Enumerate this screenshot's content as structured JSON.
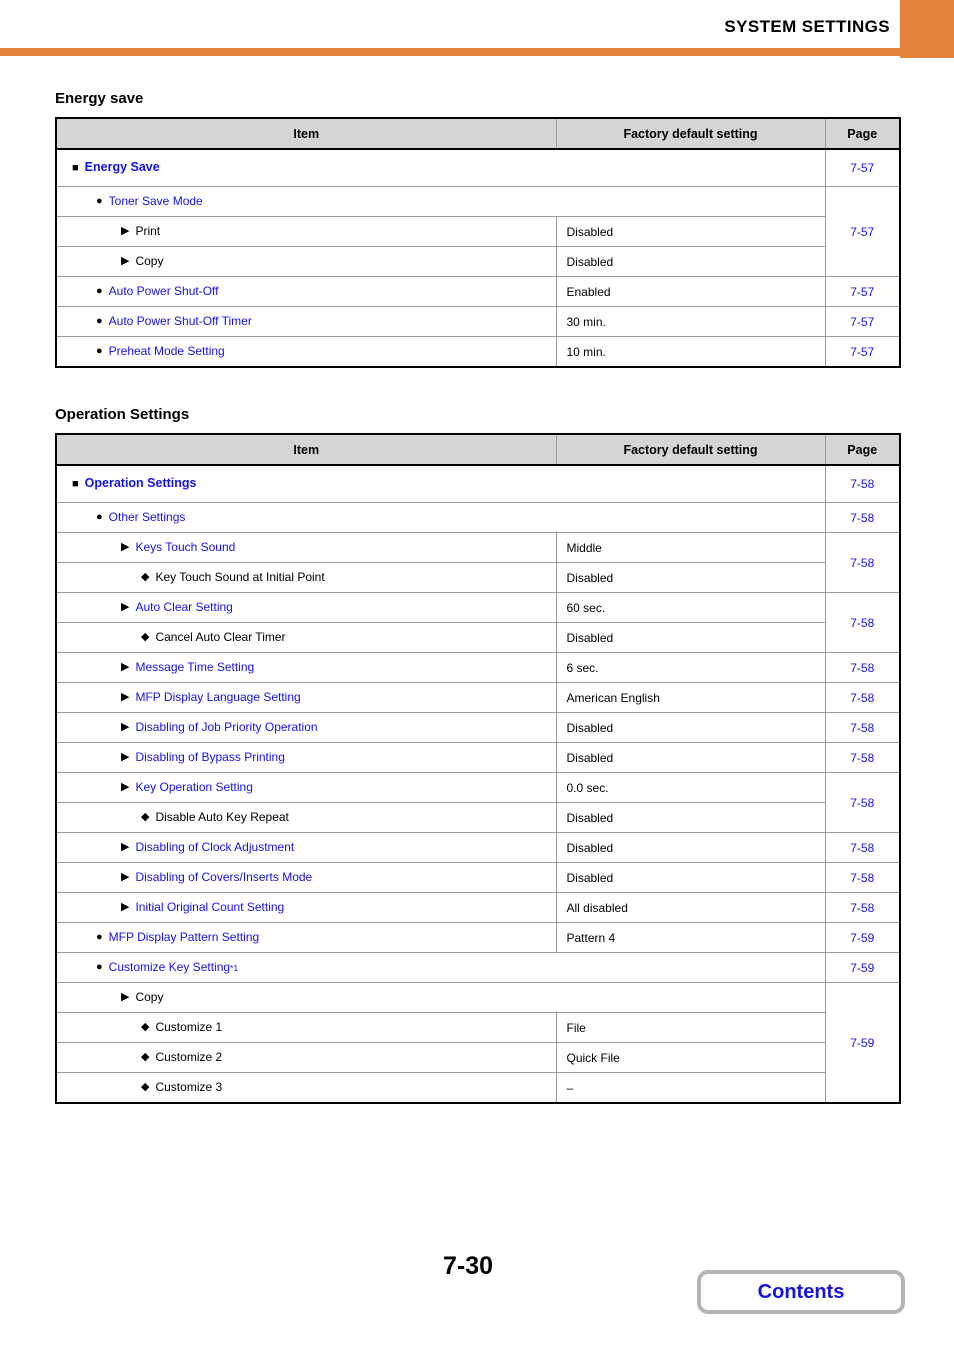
{
  "header": {
    "title": "SYSTEM SETTINGS",
    "accent_color": "#e5833a"
  },
  "link_color": "#1414e0",
  "columns": {
    "item": "Item",
    "default": "Factory default setting",
    "page": "Page"
  },
  "sections": [
    {
      "heading": "Energy save",
      "rows": [
        {
          "level": 1,
          "bullet": "square",
          "label": "Energy Save",
          "link": true,
          "value": null,
          "page": "7-57",
          "page_rowspan": 1,
          "full_width": true,
          "tall": true
        },
        {
          "level": 2,
          "bullet": "circle",
          "label": "Toner Save Mode",
          "link": true,
          "value": null,
          "page": "7-57",
          "page_rowspan": 3,
          "full_width": true,
          "tall": false
        },
        {
          "level": 3,
          "bullet": "tri",
          "label": "Print",
          "link": false,
          "value": "Disabled",
          "page": null,
          "page_rowspan": 0,
          "full_width": false,
          "tall": false
        },
        {
          "level": 3,
          "bullet": "tri",
          "label": "Copy",
          "link": false,
          "value": "Disabled",
          "page": null,
          "page_rowspan": 0,
          "full_width": false,
          "tall": false
        },
        {
          "level": 2,
          "bullet": "circle",
          "label": "Auto Power Shut-Off",
          "link": true,
          "value": "Enabled",
          "page": "7-57",
          "page_rowspan": 1,
          "full_width": false,
          "tall": false
        },
        {
          "level": 2,
          "bullet": "circle",
          "label": "Auto Power Shut-Off Timer",
          "link": true,
          "value": "30 min.",
          "page": "7-57",
          "page_rowspan": 1,
          "full_width": false,
          "tall": false
        },
        {
          "level": 2,
          "bullet": "circle",
          "label": "Preheat Mode Setting",
          "link": true,
          "value": "10 min.",
          "page": "7-57",
          "page_rowspan": 1,
          "full_width": false,
          "tall": false
        }
      ]
    },
    {
      "heading": "Operation Settings",
      "rows": [
        {
          "level": 1,
          "bullet": "square",
          "label": "Operation Settings",
          "link": true,
          "value": null,
          "page": "7-58",
          "page_rowspan": 1,
          "full_width": true,
          "tall": true
        },
        {
          "level": 2,
          "bullet": "circle",
          "label": "Other Settings",
          "link": true,
          "value": null,
          "page": "7-58",
          "page_rowspan": 1,
          "full_width": true,
          "tall": false
        },
        {
          "level": 3,
          "bullet": "tri",
          "label": "Keys Touch Sound",
          "link": true,
          "value": "Middle",
          "page": "7-58",
          "page_rowspan": 2,
          "full_width": false,
          "tall": false
        },
        {
          "level": 4,
          "bullet": "diamond",
          "label": "Key Touch Sound at Initial Point",
          "link": false,
          "value": "Disabled",
          "page": null,
          "page_rowspan": 0,
          "full_width": false,
          "tall": false
        },
        {
          "level": 3,
          "bullet": "tri",
          "label": "Auto Clear Setting",
          "link": true,
          "value": "60 sec.",
          "page": "7-58",
          "page_rowspan": 2,
          "full_width": false,
          "tall": false
        },
        {
          "level": 4,
          "bullet": "diamond",
          "label": "Cancel Auto Clear Timer",
          "link": false,
          "value": "Disabled",
          "page": null,
          "page_rowspan": 0,
          "full_width": false,
          "tall": false
        },
        {
          "level": 3,
          "bullet": "tri",
          "label": "Message Time Setting",
          "link": true,
          "value": "6 sec.",
          "page": "7-58",
          "page_rowspan": 1,
          "full_width": false,
          "tall": false
        },
        {
          "level": 3,
          "bullet": "tri",
          "label": "MFP Display Language Setting",
          "link": true,
          "value": "American English",
          "page": "7-58",
          "page_rowspan": 1,
          "full_width": false,
          "tall": false
        },
        {
          "level": 3,
          "bullet": "tri",
          "label": "Disabling of Job Priority Operation",
          "link": true,
          "value": "Disabled",
          "page": "7-58",
          "page_rowspan": 1,
          "full_width": false,
          "tall": false
        },
        {
          "level": 3,
          "bullet": "tri",
          "label": "Disabling of Bypass Printing",
          "link": true,
          "value": "Disabled",
          "page": "7-58",
          "page_rowspan": 1,
          "full_width": false,
          "tall": false
        },
        {
          "level": 3,
          "bullet": "tri",
          "label": "Key Operation Setting",
          "link": true,
          "value": "0.0 sec.",
          "page": "7-58",
          "page_rowspan": 2,
          "full_width": false,
          "tall": false
        },
        {
          "level": 4,
          "bullet": "diamond",
          "label": "Disable Auto Key Repeat",
          "link": false,
          "value": "Disabled",
          "page": null,
          "page_rowspan": 0,
          "full_width": false,
          "tall": false
        },
        {
          "level": 3,
          "bullet": "tri",
          "label": "Disabling of Clock Adjustment",
          "link": true,
          "value": "Disabled",
          "page": "7-58",
          "page_rowspan": 1,
          "full_width": false,
          "tall": false
        },
        {
          "level": 3,
          "bullet": "tri",
          "label": "Disabling of Covers/Inserts Mode",
          "link": true,
          "value": "Disabled",
          "page": "7-58",
          "page_rowspan": 1,
          "full_width": false,
          "tall": false
        },
        {
          "level": 3,
          "bullet": "tri",
          "label": "Initial Original Count Setting",
          "link": true,
          "value": "All disabled",
          "page": "7-58",
          "page_rowspan": 1,
          "full_width": false,
          "tall": false
        },
        {
          "level": 2,
          "bullet": "circle",
          "label": "MFP Display Pattern Setting",
          "link": true,
          "value": "Pattern 4",
          "page": "7-59",
          "page_rowspan": 1,
          "full_width": false,
          "tall": false
        },
        {
          "level": 2,
          "bullet": "circle",
          "label": "Customize Key Setting",
          "link": true,
          "sup": "*1",
          "value": null,
          "page": "7-59",
          "page_rowspan": 1,
          "full_width": true,
          "tall": false
        },
        {
          "level": 3,
          "bullet": "tri",
          "label": "Copy",
          "link": false,
          "value": null,
          "page": "7-59",
          "page_rowspan": 4,
          "full_width": true,
          "tall": false
        },
        {
          "level": 4,
          "bullet": "diamond",
          "label": "Customize 1",
          "link": false,
          "value": "File",
          "page": null,
          "page_rowspan": 0,
          "full_width": false,
          "tall": false
        },
        {
          "level": 4,
          "bullet": "diamond",
          "label": "Customize 2",
          "link": false,
          "value": "Quick File",
          "page": null,
          "page_rowspan": 0,
          "full_width": false,
          "tall": false
        },
        {
          "level": 4,
          "bullet": "diamond",
          "label": "Customize 3",
          "link": false,
          "value": "–",
          "page": null,
          "page_rowspan": 0,
          "full_width": false,
          "tall": false
        }
      ]
    }
  ],
  "footer": {
    "page_number": "7-30",
    "contents_label": "Contents"
  }
}
